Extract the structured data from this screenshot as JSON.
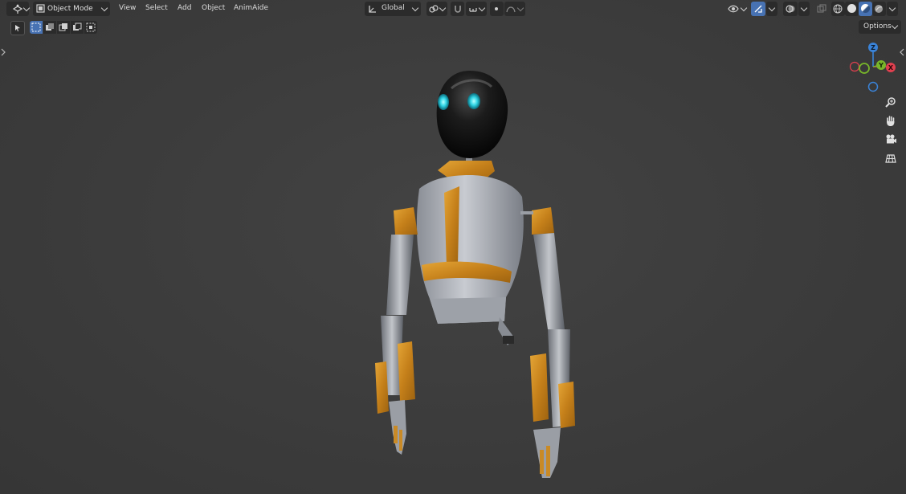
{
  "header": {
    "mode_label": "Object Mode",
    "menus": [
      "View",
      "Select",
      "Add",
      "Object",
      "AnimAide"
    ],
    "transform_orientation": "Global",
    "options_label": "Options"
  },
  "gizmo": {
    "axes": {
      "z": "Z",
      "y": "Y",
      "x": "X"
    },
    "colors": {
      "x": "#e0404f",
      "y": "#78b62a",
      "z": "#3a83d8"
    }
  },
  "colors": {
    "accent": "#4772b3",
    "viewport_bg": "#3d3d3d",
    "orange": "#d8921e"
  },
  "icons": {
    "editor_type": "3d-viewport-icon",
    "select_box": "select-box-icon",
    "zoom": "zoom-icon",
    "pan": "hand-icon",
    "camera": "camera-icon",
    "perspective": "grid-icon"
  }
}
